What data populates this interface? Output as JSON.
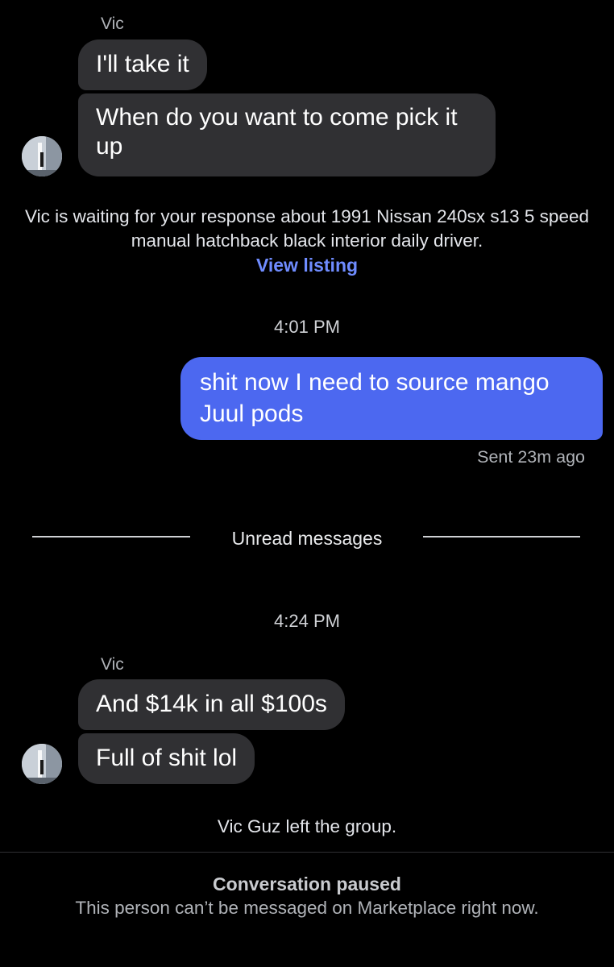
{
  "conversation": {
    "block1": {
      "sender": "Vic",
      "messages": [
        "I'll take it",
        "When do you want to come pick it up"
      ]
    },
    "listing_notice": {
      "text": "Vic is waiting for your response about 1991 Nissan 240sx s13 5 speed manual hatchback black interior daily driver.",
      "link": "View listing"
    },
    "time1": "4:01 PM",
    "outgoing": {
      "text": "shit now I need to source mango Juul pods",
      "status": "Sent 23m ago"
    },
    "unread_label": "Unread messages",
    "time2": "4:24 PM",
    "block2": {
      "sender": "Vic",
      "messages": [
        "And $14k in all $100s",
        "Full of shit lol"
      ]
    },
    "left_notice": "Vic Guz left the group."
  },
  "footer": {
    "title": "Conversation paused",
    "subtitle": "This person can’t be messaged on Marketplace right now."
  },
  "colors": {
    "background": "#000000",
    "incoming_bubble": "#303033",
    "outgoing_bubble": "#4c68f0",
    "link": "#6f8cff"
  },
  "icons": {
    "avatar": "contact-avatar-photo"
  }
}
